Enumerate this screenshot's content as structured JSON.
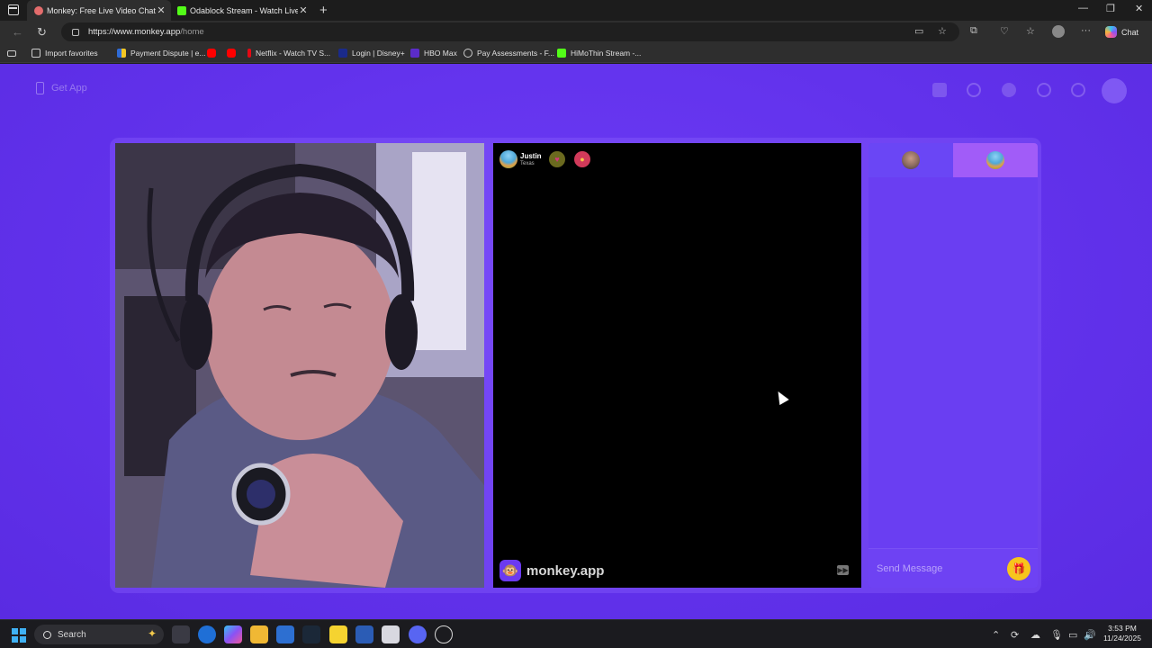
{
  "browser": {
    "tabs": [
      {
        "title": "Monkey: Free Live Video Chat",
        "active": true
      },
      {
        "title": "Odablock Stream - Watch Live on",
        "active": false
      }
    ],
    "url_host": "https://www.monkey.app",
    "url_path": "/home",
    "chat_label": "Chat"
  },
  "favorites": [
    {
      "label": "Import favorites",
      "icon": "import-icon"
    },
    {
      "label": "Payment Dispute | e...",
      "icon": "payment-icon"
    },
    {
      "label": "",
      "icon": "youtube-icon"
    },
    {
      "label": "",
      "icon": "youtube-icon"
    },
    {
      "label": "Netflix - Watch TV S...",
      "icon": "netflix-icon"
    },
    {
      "label": "Login | Disney+",
      "icon": "disney-icon"
    },
    {
      "label": "HBO Max",
      "icon": "hbo-icon"
    },
    {
      "label": "Pay Assessments - F...",
      "icon": "globe-icon"
    },
    {
      "label": "HiMoThin Stream -...",
      "icon": "kick-icon"
    }
  ],
  "page": {
    "get_app_label": "Get App",
    "peer": {
      "name": "Justin",
      "location": "Texas"
    },
    "brand": "monkey.app",
    "message_placeholder": "Send Message"
  },
  "taskbar": {
    "search_label": "Search",
    "time": "3:53 PM",
    "date": "11/24/2025"
  },
  "colors": {
    "page_bg": "#6232ec",
    "chat_panel": "#6a3ef2",
    "active_chat_tab": "#a15cf8",
    "gift_button": "#f7c51c"
  }
}
